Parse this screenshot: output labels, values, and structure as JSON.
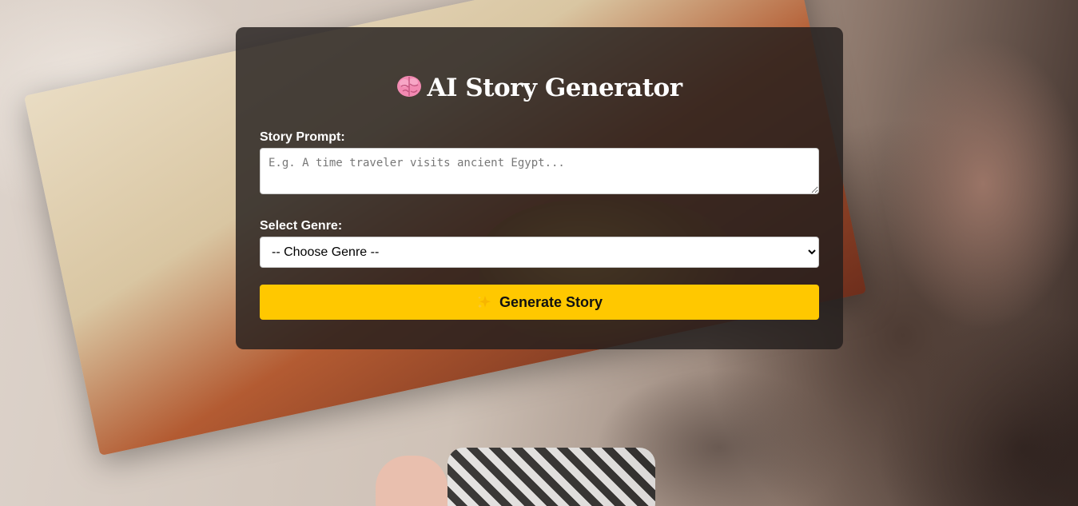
{
  "app": {
    "title": "AI Story Generator",
    "title_icon": "brain-icon"
  },
  "form": {
    "prompt_label": "Story Prompt:",
    "prompt_value": "",
    "prompt_placeholder": "E.g. A time traveler visits ancient Egypt...",
    "genre_label": "Select Genre:",
    "genre_selected": "-- Choose Genre --",
    "generate_label": "Generate Story",
    "generate_icon": "sparkle-icon"
  },
  "colors": {
    "card_background": "#231e1d",
    "button": "#ffc800",
    "title_text": "#ffffff"
  }
}
